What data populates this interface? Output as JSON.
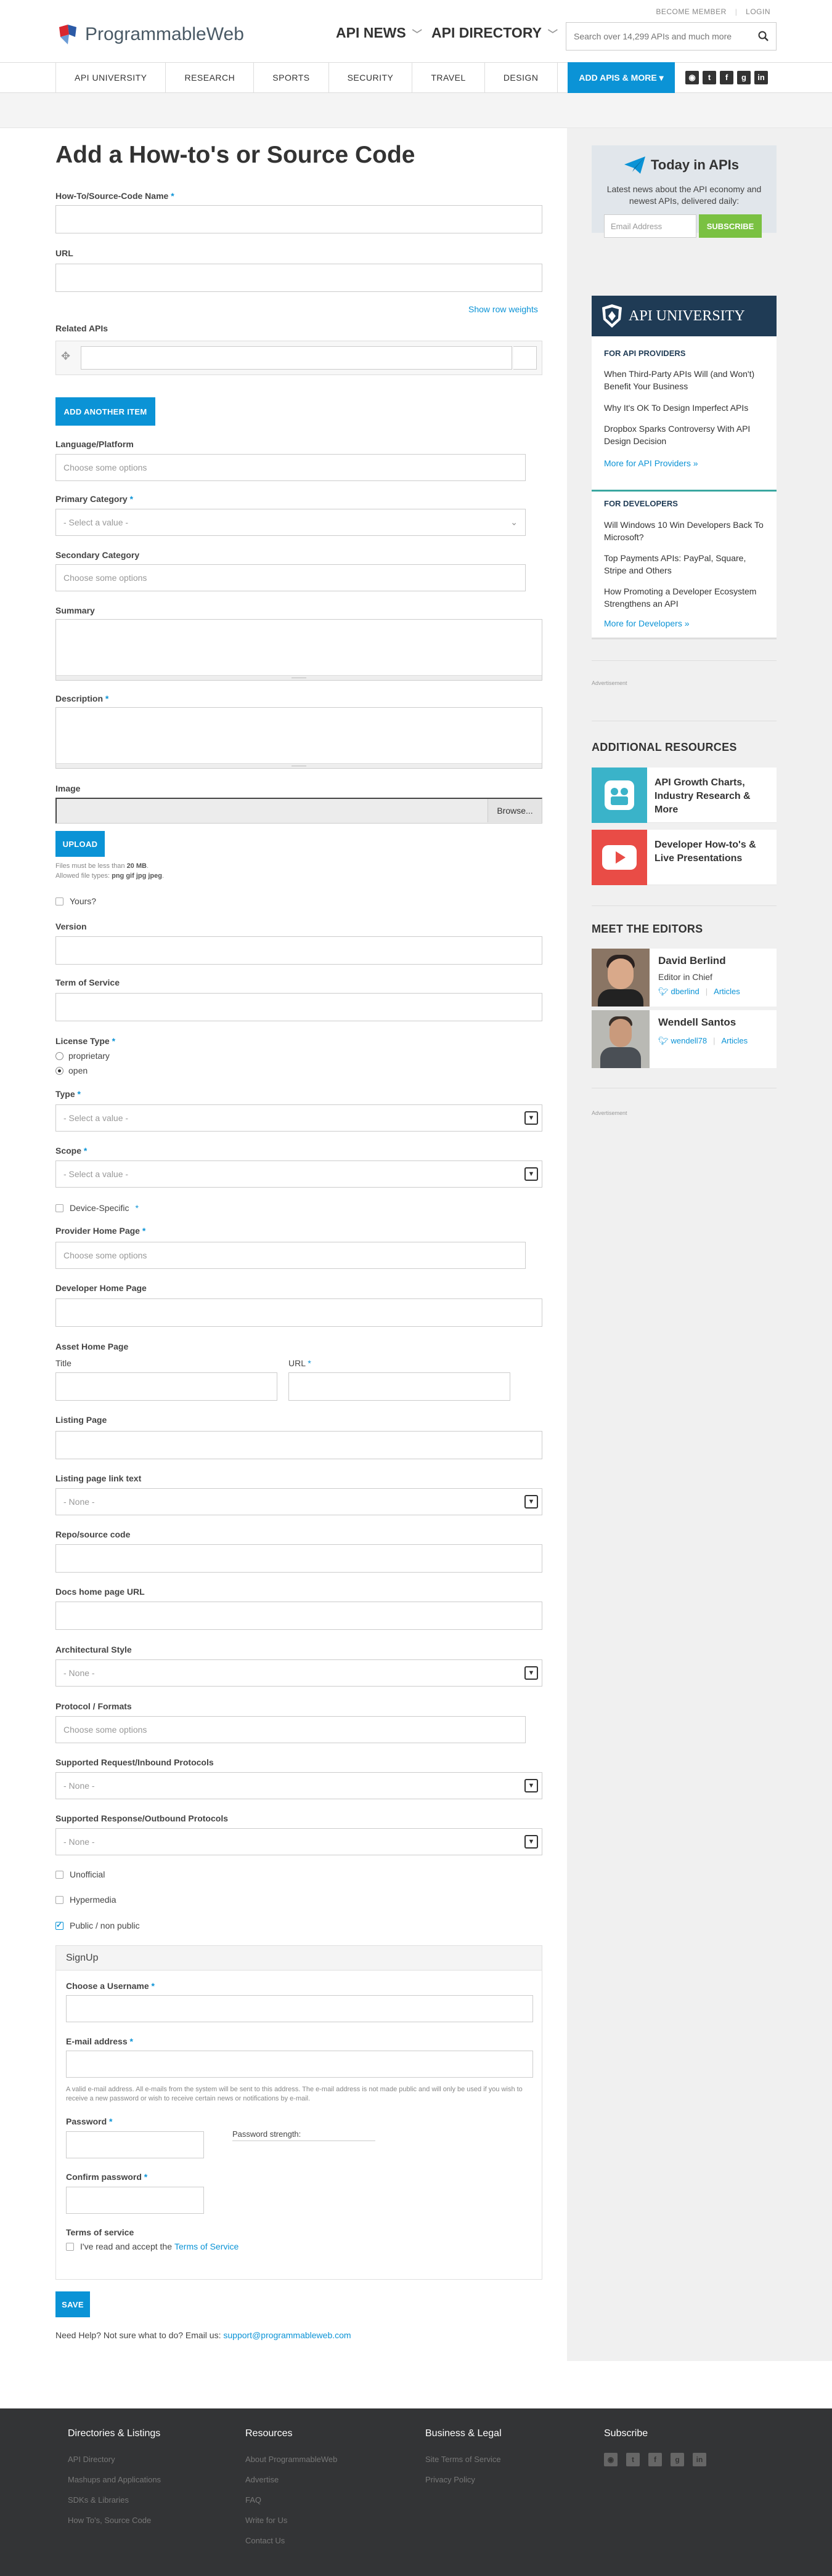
{
  "header": {
    "become_member": "BECOME MEMBER",
    "login": "LOGIN",
    "logo_text": "ProgrammableWeb",
    "nav_api_news": "API NEWS",
    "nav_api_directory": "API DIRECTORY",
    "search_placeholder": "Search over 14,299 APIs and much more",
    "subnav": [
      "API UNIVERSITY",
      "RESEARCH",
      "SPORTS",
      "SECURITY",
      "TRAVEL",
      "DESIGN"
    ],
    "add_apis": "ADD APIS & MORE",
    "social": [
      "rss",
      "twitter",
      "facebook",
      "google-plus",
      "linkedin"
    ]
  },
  "form": {
    "title": "Add a How-to's or Source Code",
    "name_label": "How-To/Source-Code Name",
    "url_label": "URL",
    "show_row_weights": "Show row weights",
    "related_apis_label": "Related APIs",
    "add_another_item": "ADD ANOTHER ITEM",
    "language_label": "Language/Platform",
    "choose_options": "Choose some options",
    "primary_category_label": "Primary Category",
    "select_value": "- Select a value -",
    "secondary_category_label": "Secondary Category",
    "summary_label": "Summary",
    "description_label": "Description",
    "image_label": "Image",
    "browse": "Browse...",
    "upload": "UPLOAD",
    "file_note_1": "Files must be less than",
    "file_note_size": "20 MB",
    "file_note_2": "Allowed file types:",
    "file_note_types": "png gif jpg jpeg",
    "yours_label": "Yours?",
    "version_label": "Version",
    "terms_label": "Term of Service",
    "license_label": "License Type",
    "license_options": [
      "proprietary",
      "open"
    ],
    "license_selected": "open",
    "type_label": "Type",
    "scope_label": "Scope",
    "device_specific_label": "Device-Specific",
    "provider_home_label": "Provider Home Page",
    "developer_home_label": "Developer Home Page",
    "asset_home_label": "Asset Home Page",
    "asset_title_label": "Title",
    "asset_url_label": "URL",
    "listing_page_label": "Listing Page",
    "listing_link_text_label": "Listing page link text",
    "none_value": "- None -",
    "repo_label": "Repo/source code",
    "docs_label": "Docs home page URL",
    "arch_label": "Architectural Style",
    "protocol_label": "Protocol / Formats",
    "request_protocols_label": "Supported Request/Inbound Protocols",
    "response_protocols_label": "Supported Response/Outbound Protocols",
    "unofficial_label": "Unofficial",
    "hypermedia_label": "Hypermedia",
    "public_label": "Public / non public",
    "public_checked": true,
    "signup_title": "SignUp",
    "username_label": "Choose a Username",
    "email_label": "E-mail address",
    "email_help": "A valid e-mail address. All e-mails from the system will be sent to this address. The e-mail address is not made public and will only be used if you wish to receive a new password or wish to receive certain news or notifications by e-mail.",
    "password_label": "Password",
    "password_strength": "Password strength:",
    "confirm_password_label": "Confirm password",
    "tos_title": "Terms of service",
    "tos_text": "I've read and accept the",
    "tos_link": "Terms of Service",
    "save": "SAVE",
    "help_text": "Need Help? Not sure what to do? Email us:",
    "help_email": "support@programmableweb.com"
  },
  "sidebar": {
    "today_title": "Today in APIs",
    "today_text": "Latest news about the API economy and newest APIs, delivered daily:",
    "email_placeholder": "Email Address",
    "subscribe": "SUBSCRIBE",
    "api_university": "API UNIVERSITY",
    "providers_head": "FOR API PROVIDERS",
    "providers_items": [
      "When Third-Party APIs Will (and Won't) Benefit Your Business",
      "Why It's OK To Design Imperfect APIs",
      "Dropbox Sparks Controversy With API Design Decision"
    ],
    "providers_more": "More for API Providers »",
    "developers_head": "FOR DEVELOPERS",
    "developers_items": [
      "Will Windows 10 Win Developers Back To Microsoft?",
      "Top Payments APIs: PayPal, Square, Stripe and Others",
      "How Promoting a Developer Ecosystem Strengthens an API"
    ],
    "developers_more": "More for Developers »",
    "advertisement": "Advertisement",
    "additional_resources": "ADDITIONAL RESOURCES",
    "resource_1": "API Growth Charts, Industry Research & More",
    "resource_2": "Developer How-to's & Live Presentations",
    "meet_editors": "MEET THE EDITORS",
    "editors": [
      {
        "name": "David Berlind",
        "role": "Editor in Chief",
        "handle": "dberlind",
        "articles": "Articles"
      },
      {
        "name": "Wendell Santos",
        "role": "",
        "handle": "wendell78",
        "articles": "Articles"
      }
    ]
  },
  "footer": {
    "col1_title": "Directories & Listings",
    "col1_links": [
      "API Directory",
      "Mashups and Applications",
      "SDKs & Libraries",
      "How To's, Source Code"
    ],
    "col2_title": "Resources",
    "col2_links": [
      "About ProgrammableWeb",
      "Advertise",
      "FAQ",
      "Write for Us",
      "Contact Us"
    ],
    "col3_title": "Business & Legal",
    "col3_links": [
      "Site Terms of Service",
      "Privacy Policy"
    ],
    "col4_title": "Subscribe"
  },
  "colors": {
    "accent": "#0b93d6",
    "footer_bg": "#333436",
    "green": "#7ac142",
    "navy": "#1f3b55"
  }
}
